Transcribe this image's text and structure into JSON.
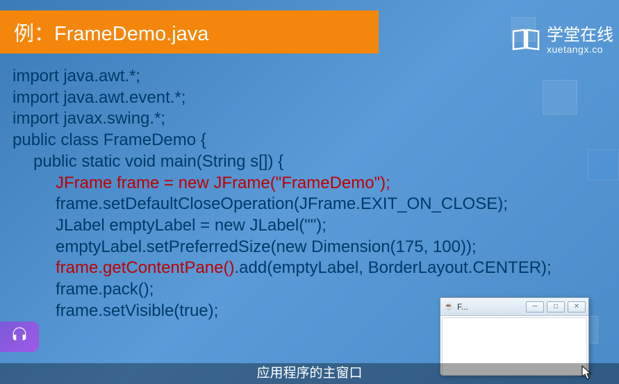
{
  "title": "例：FrameDemo.java",
  "logo": {
    "cn": "学堂在线",
    "en": "xuetangx.co"
  },
  "code": {
    "l1": "import java.awt.*;",
    "l2": "import java.awt.event.*;",
    "l3": "import javax.swing.*;",
    "l4": "public class FrameDemo {",
    "l5": "public static void main(String s[]) {",
    "l6a": "JFrame frame = new JFrame(\"FrameDemo\");",
    "l7": "frame.setDefaultCloseOperation(JFrame.EXIT_ON_CLOSE);",
    "l8": "JLabel emptyLabel = new JLabel(\"\");",
    "l9": "emptyLabel.setPreferredSize(new Dimension(175, 100));",
    "l10a": "frame.getContentPane()",
    "l10b": ".add(emptyLabel, BorderLayout.CENTER);",
    "l11": "frame.pack();",
    "l12": "frame.setVisible(true);",
    "l13": "}"
  },
  "miniWindow": {
    "title": "F..."
  },
  "caption": "应用程序的主窗口"
}
